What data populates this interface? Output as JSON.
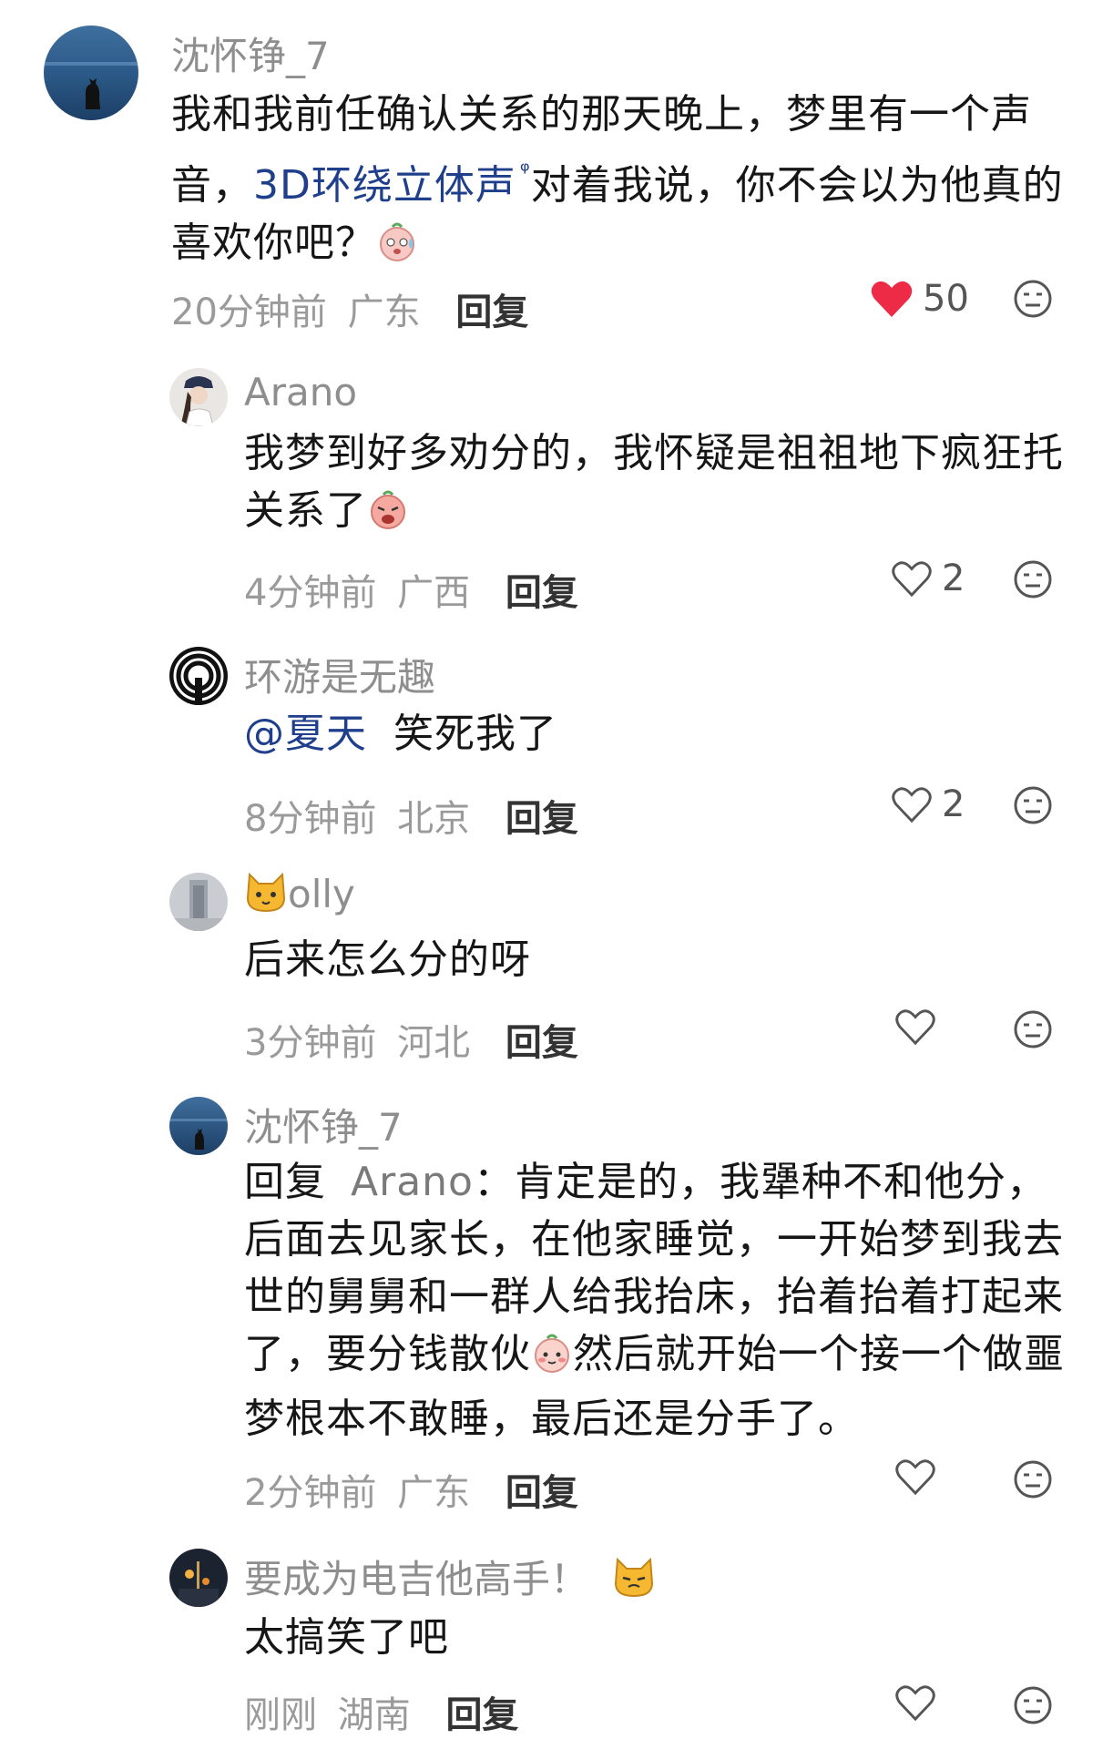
{
  "comments": [
    {
      "user": "沈怀铮_7",
      "text_pre": "我和我前任确认关系的那天晚上，梦里有一个声音，",
      "link": "3D环绕立体声",
      "text_post": "对着我说，你不会以为他真的喜欢你吧？",
      "time": "20分钟前",
      "location": "广东",
      "reply": "回复",
      "likes": "50",
      "liked": true
    },
    {
      "user": "Arano",
      "text": "我梦到好多劝分的，我怀疑是祖祖地下疯狂托关系了",
      "time": "4分钟前",
      "location": "广西",
      "reply": "回复",
      "likes": "2"
    },
    {
      "user": "环游是无趣",
      "mention": "@夏天",
      "text": "笑死我了",
      "time": "8分钟前",
      "location": "北京",
      "reply": "回复",
      "likes": "2"
    },
    {
      "user": "olly",
      "text": "后来怎么分的呀",
      "time": "3分钟前",
      "location": "河北",
      "reply": "回复"
    },
    {
      "user": "沈怀铮_7",
      "reply_prefix": "回复",
      "reply_to": "Arano",
      "text_pre": "：肯定是的，我犟种不和他分，后面去见家长，在他家睡觉，一开始梦到我去世的舅舅和一群人给我抬床，抬着抬着打起来了，要分钱散伙",
      "text_post": "然后就开始一个接一个做噩梦根本不敢睡，最后还是分手了。",
      "time": "2分钟前",
      "location": "广东",
      "reply": "回复"
    },
    {
      "user": "要成为电吉他高手！",
      "text": "太搞笑了吧",
      "time": "刚刚",
      "location": "湖南",
      "reply": "回复"
    }
  ],
  "colors": {
    "accent_link": "#1f3f8c",
    "like_red": "#ee2b47",
    "meta_gray": "#9a9a9a"
  },
  "icons": [
    "heart-icon",
    "dislike-face-icon",
    "search-icon",
    "cat-emoji-icon",
    "sweat-emoji-icon",
    "cry-emoji-icon",
    "shy-emoji-icon"
  ]
}
